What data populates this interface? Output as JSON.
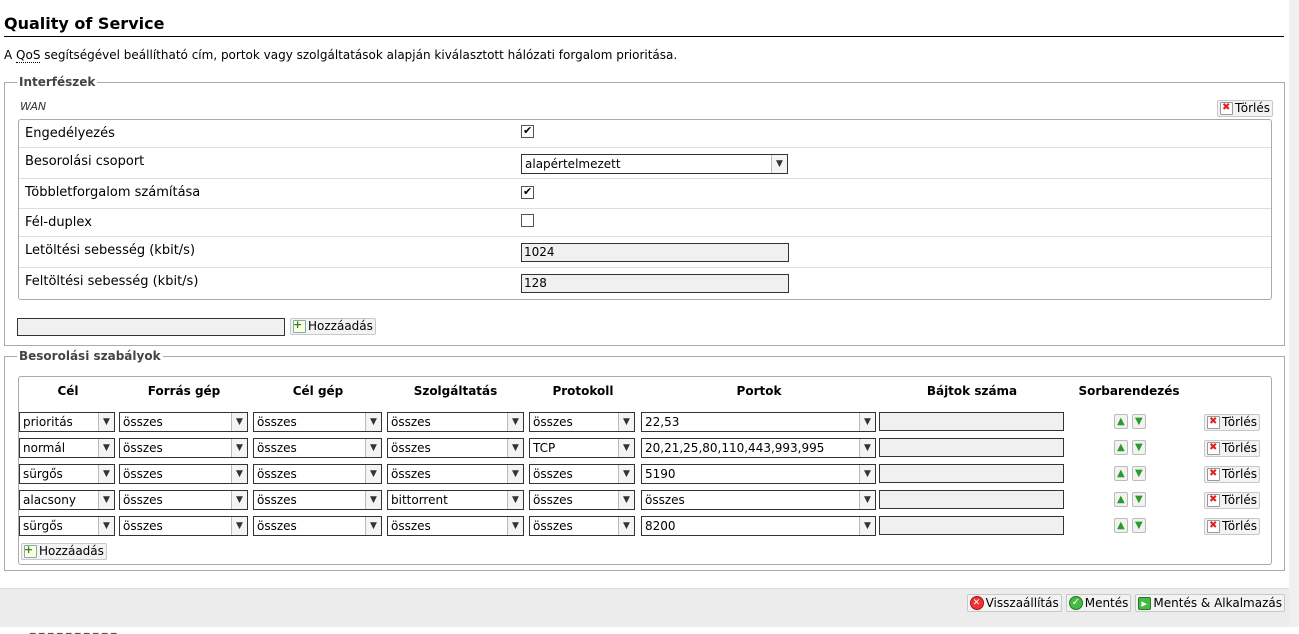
{
  "page": {
    "title": "Quality of Service",
    "desc_prefix": "A ",
    "desc_abbr": "QoS",
    "desc_rest": " segítségével beállítható cím, portok vagy szolgáltatások alapján kiválasztott hálózati forgalom prioritása."
  },
  "interfaces": {
    "legend": "Interfészek",
    "section_name": "WAN",
    "delete_label": "Törlés",
    "fields": {
      "enable_label": "Engedélyezés",
      "enable_checked": true,
      "group_label": "Besorolási csoport",
      "group_value": "alapértelmezett",
      "overhead_label": "Többletforgalom számítása",
      "overhead_checked": true,
      "halfduplex_label": "Fél-duplex",
      "halfduplex_checked": false,
      "download_label": "Letöltési sebesség (kbit/s)",
      "download_value": "1024",
      "upload_label": "Feltöltési sebesség (kbit/s)",
      "upload_value": "128"
    },
    "new_input_value": "",
    "add_label": "Hozzáadás"
  },
  "rules": {
    "legend": "Besorolási szabályok",
    "headers": {
      "target": "Cél",
      "src": "Forrás gép",
      "dst": "Cél gép",
      "service": "Szolgáltatás",
      "proto": "Protokoll",
      "ports": "Portok",
      "bytes": "Bájtok száma",
      "sort": "Sorbarendezés"
    },
    "rows": [
      {
        "target": "prioritás",
        "src": "összes",
        "dst": "összes",
        "service": "összes",
        "proto": "összes",
        "ports": "22,53",
        "bytes": "",
        "delete": "Törlés"
      },
      {
        "target": "normál",
        "src": "összes",
        "dst": "összes",
        "service": "összes",
        "proto": "TCP",
        "ports": "20,21,25,80,110,443,993,995",
        "bytes": "",
        "delete": "Törlés"
      },
      {
        "target": "sürgős",
        "src": "összes",
        "dst": "összes",
        "service": "összes",
        "proto": "összes",
        "ports": "5190",
        "bytes": "",
        "delete": "Törlés"
      },
      {
        "target": "alacsony",
        "src": "összes",
        "dst": "összes",
        "service": "bittorrent",
        "proto": "összes",
        "ports": "összes",
        "bytes": "",
        "delete": "Törlés"
      },
      {
        "target": "sürgős",
        "src": "összes",
        "dst": "összes",
        "service": "összes",
        "proto": "összes",
        "ports": "8200",
        "bytes": "",
        "delete": "Törlés"
      }
    ],
    "add_label": "Hozzáadás"
  },
  "footer": {
    "reset_label": "Visszaállítás",
    "save_label": "Mentés",
    "apply_label": "Mentés & Alkalmazás",
    "partial_text": "_ _ _ _ _ _ _ _ _ _"
  }
}
